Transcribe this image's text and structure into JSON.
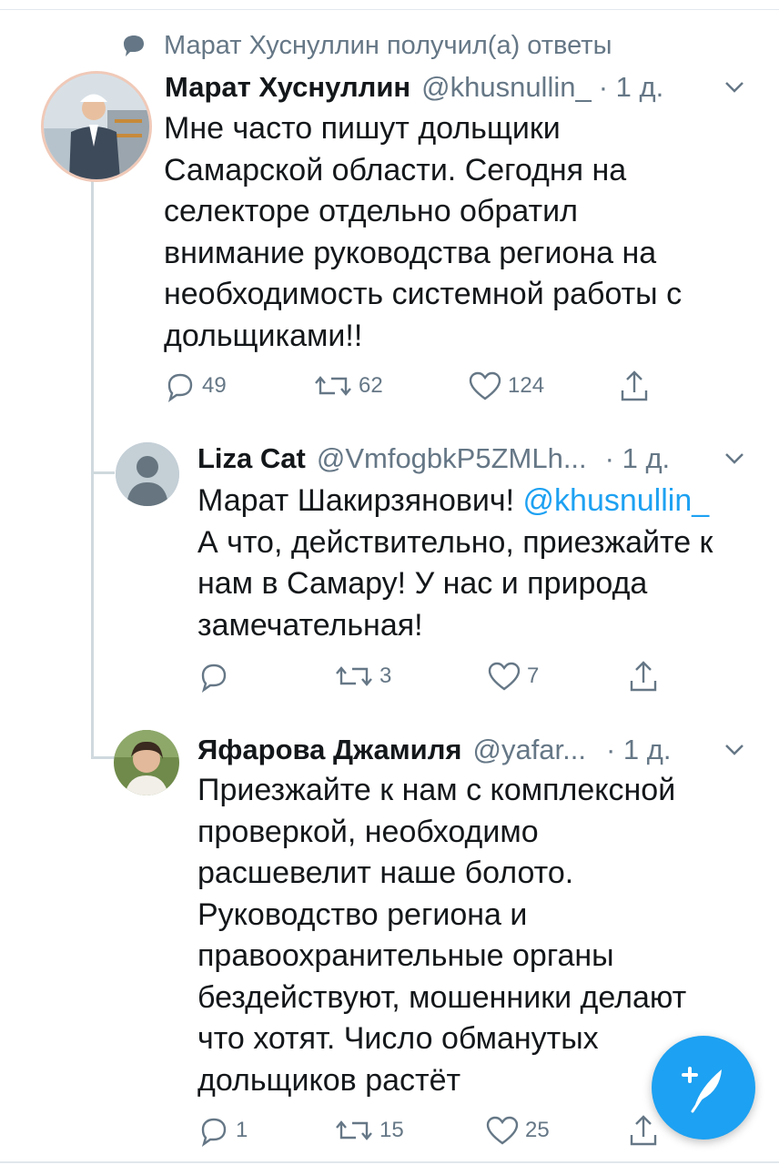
{
  "context": {
    "text": "Марат Хуснуллин получил(а) ответы",
    "icon": "reply-bubble-icon"
  },
  "tweets": [
    {
      "name": "Марат Хуснуллин",
      "handle": "@khusnullin_",
      "time": "· 1 д.",
      "text": "Мне часто пишут дольщики\nСамарской области. Сегодня на\nселекторе отдельно обратил\nвнимание руководства региона на\nнеобходимость системной работы с\nдольщиками!!",
      "replies": "49",
      "retweets": "62",
      "likes": "124"
    },
    {
      "name": "Liza Cat",
      "handle": "@VmfogbkP5ZMLh...",
      "time": "· 1 д.",
      "text_prefix": "Марат Шакирзянович! ",
      "mention": "@khusnullin_",
      "text": "\nА что, действительно, приезжайте к\nнам в Самару! У нас и природа\nзамечательная!",
      "replies": "",
      "retweets": "3",
      "likes": "7"
    },
    {
      "name": "Яфарова Джамиля",
      "handle": "@yafar...",
      "time": "· 1 д.",
      "text": "Приезжайте к нам с комплексной\nпроверкой, необходимо\nрасшевелит наше болото.\nРуководство региона и\nправоохранительные органы\nбездействуют, мошенники делают\nчто хотят. Число обманутых\nдольщиков растёт",
      "replies": "1",
      "retweets": "15",
      "likes": "25"
    }
  ],
  "colors": {
    "accent": "#1da1f2",
    "muted": "#657786",
    "text": "#14171a"
  },
  "fab": {
    "icon": "compose-feather-icon"
  }
}
